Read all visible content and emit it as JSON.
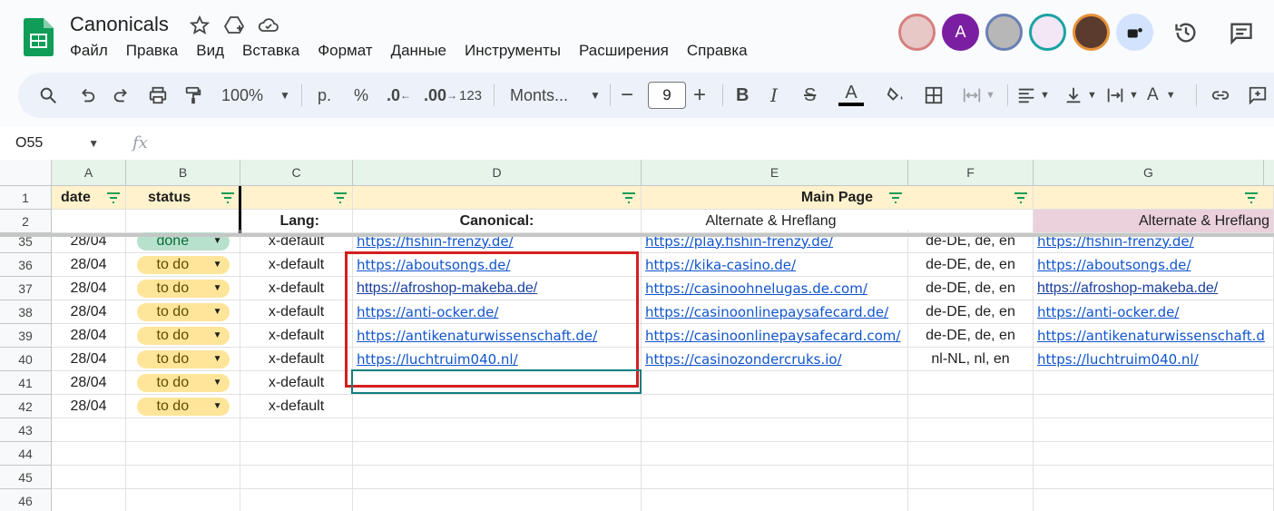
{
  "app": {
    "title": "Canonicals",
    "menu": [
      "Файл",
      "Правка",
      "Вид",
      "Вставка",
      "Формат",
      "Данные",
      "Инструменты",
      "Расширения",
      "Справка"
    ],
    "avatar_letter": "A"
  },
  "toolbar": {
    "zoom": "100%",
    "currency": "р.",
    "percent": "%",
    "dec_less": ".0",
    "dec_more": ".00",
    "number_format": "123",
    "font": "Monts...",
    "font_size": "9"
  },
  "formula": {
    "cell_ref": "O55",
    "fx": "fx"
  },
  "columns": [
    "A",
    "B",
    "C",
    "D",
    "E",
    "F",
    "G"
  ],
  "header_rows": {
    "row1": {
      "num": "1",
      "a": "date",
      "b": "status",
      "e": "Main Page"
    },
    "row2": {
      "num": "2",
      "c": "Lang:",
      "d": "Canonical:",
      "e": "Alternate & Hreflang",
      "g": "Alternate & Hreflang"
    }
  },
  "rows": [
    {
      "num": "35",
      "date": "28/04",
      "status": "done",
      "lang": "x-default",
      "d": "https://fishin-frenzy.de/",
      "e": "https://play.fishin-frenzy.de/",
      "f": "de-DE, de, en",
      "g": "https://fishin-frenzy.de/"
    },
    {
      "num": "36",
      "date": "28/04",
      "status": "to do",
      "lang": "x-default",
      "d": "https://aboutsongs.de/",
      "e": "https://kika-casino.de/",
      "f": "de-DE, de, en",
      "g": "https://aboutsongs.de/"
    },
    {
      "num": "37",
      "date": "28/04",
      "status": "to do",
      "lang": "x-default",
      "d": "https://afroshop-makeba.de/",
      "e": "https://casinoohnelugas.de.com/",
      "f": "de-DE, de, en",
      "g": "https://afroshop-makeba.de/"
    },
    {
      "num": "38",
      "date": "28/04",
      "status": "to do",
      "lang": "x-default",
      "d": "https://anti-ocker.de/",
      "e": "https://casinoonlinepaysafecard.de/",
      "f": "de-DE, de, en",
      "g": "https://anti-ocker.de/"
    },
    {
      "num": "39",
      "date": "28/04",
      "status": "to do",
      "lang": "x-default",
      "d": "https://antikenaturwissenschaft.de/",
      "e": "https://casinoonlinepaysafecard.com/",
      "f": "de-DE, de, en",
      "g": "https://antikenaturwissenschaft.d"
    },
    {
      "num": "40",
      "date": "28/04",
      "status": "to do",
      "lang": "x-default",
      "d": "https://luchtruim040.nl/",
      "e": "https://casinozondercruks.io/",
      "f": "nl-NL, nl, en",
      "g": "https://luchtruim040.nl/"
    },
    {
      "num": "41",
      "date": "28/04",
      "status": "to do",
      "lang": "x-default",
      "d": "",
      "e": "",
      "f": "",
      "g": ""
    },
    {
      "num": "42",
      "date": "28/04",
      "status": "to do",
      "lang": "x-default",
      "d": "",
      "e": "",
      "f": "",
      "g": ""
    }
  ],
  "empty_rows": [
    "43",
    "44",
    "45",
    "46"
  ]
}
